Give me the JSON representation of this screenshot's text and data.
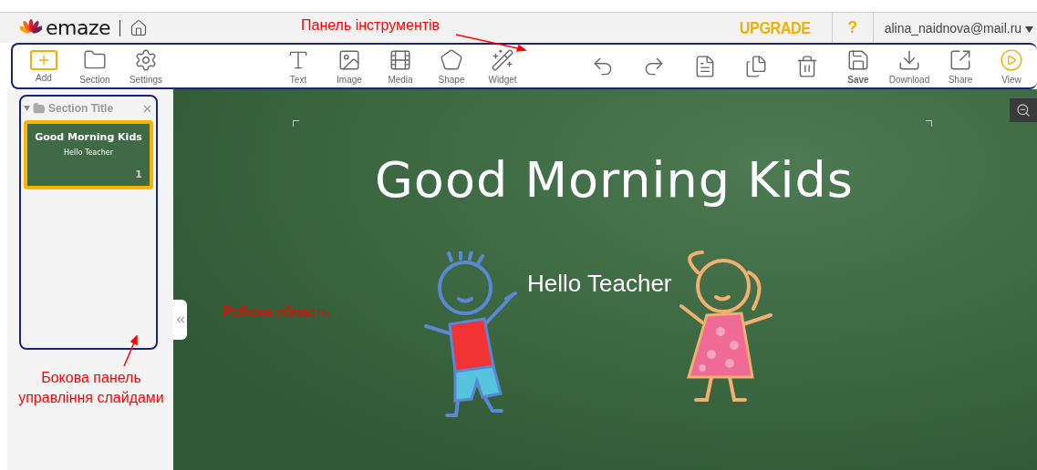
{
  "header": {
    "brand": "emaze",
    "upgrade": "UPGRADE",
    "help": "?",
    "user": "alina_naidnova@mail.ru"
  },
  "toolbar": {
    "left": [
      {
        "kind": "add",
        "label": "Add"
      },
      {
        "kind": "section",
        "label": "Section"
      },
      {
        "kind": "settings",
        "label": "Settings"
      }
    ],
    "center": [
      {
        "kind": "text",
        "label": "Text"
      },
      {
        "kind": "image",
        "label": "Image"
      },
      {
        "kind": "media",
        "label": "Media"
      },
      {
        "kind": "shape",
        "label": "Shape"
      },
      {
        "kind": "widget",
        "label": "Widget"
      }
    ],
    "right": [
      {
        "kind": "undo"
      },
      {
        "kind": "redo"
      },
      {
        "kind": "page"
      },
      {
        "kind": "duplicate"
      },
      {
        "kind": "delete"
      },
      {
        "kind": "save",
        "label": "Save"
      },
      {
        "kind": "download",
        "label": "Download"
      },
      {
        "kind": "share",
        "label": "Share"
      },
      {
        "kind": "view",
        "label": "View"
      }
    ]
  },
  "sidebar": {
    "section_title": "Section Title",
    "expanded": true,
    "slides": [
      {
        "title": "Good Morning Kids",
        "subtitle": "Hello Teacher",
        "number": "1",
        "selected": true
      }
    ]
  },
  "slide": {
    "title": "Good Morning Kids",
    "subtitle": "Hello Teacher"
  },
  "annotations": {
    "toolbar": "Панель інструментів",
    "workspace": "Робоча область",
    "sidebar": "Бокова панель управління слайдами"
  }
}
